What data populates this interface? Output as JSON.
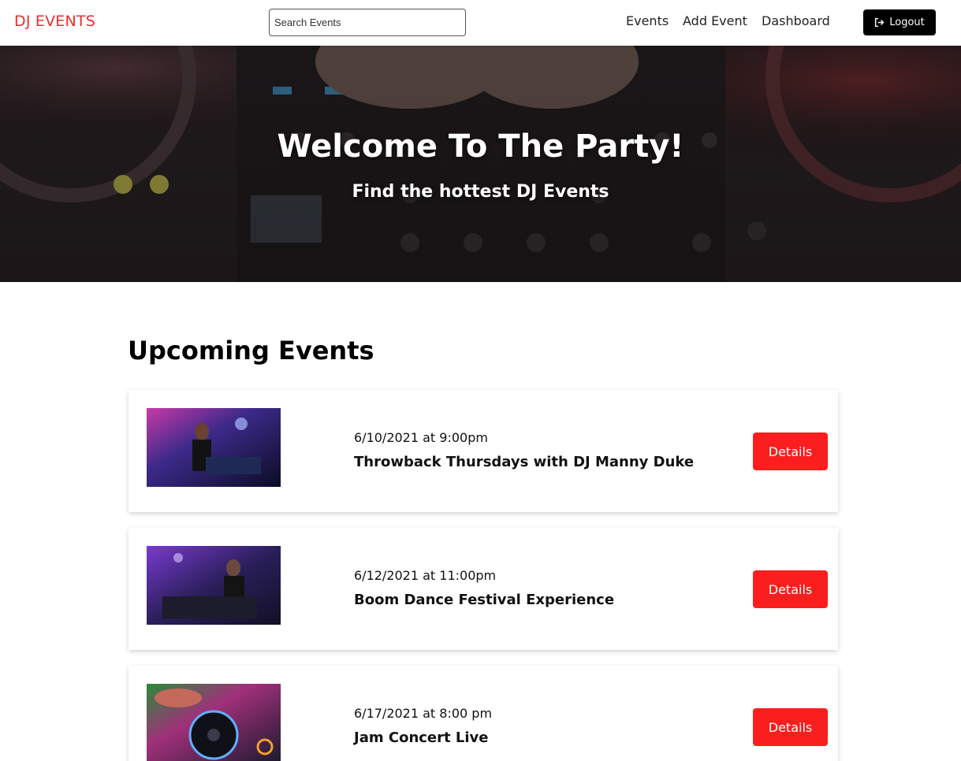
{
  "header": {
    "logo": "DJ EVENTS",
    "search_placeholder": "Search Events",
    "nav": [
      "Events",
      "Add Event",
      "Dashboard"
    ],
    "logout_label": "Logout"
  },
  "hero": {
    "title": "Welcome To The Party!",
    "subtitle": "Find the hottest DJ Events"
  },
  "section": {
    "title": "Upcoming Events"
  },
  "events": [
    {
      "date": "6/10/2021 at 9:00pm",
      "title": "Throwback Thursdays with DJ Manny Duke",
      "button": "Details"
    },
    {
      "date": "6/12/2021 at 11:00pm",
      "title": "Boom Dance Festival Experience",
      "button": "Details"
    },
    {
      "date": "6/17/2021 at 8:00 pm",
      "title": "Jam Concert Live",
      "button": "Details"
    }
  ],
  "colors": {
    "brand": "#ef2b2b",
    "button": "#fa1e1e",
    "logout_bg": "#000000"
  }
}
